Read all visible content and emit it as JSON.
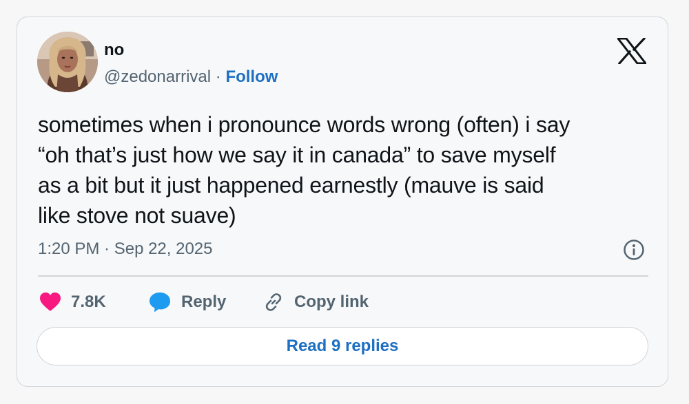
{
  "tweet": {
    "author": {
      "display_name": "no",
      "handle": "@zedonarrival",
      "separator": " · ",
      "follow_label": "Follow",
      "avatar_icon": "profile-photo"
    },
    "platform_icon": "x-logo-icon",
    "text_lines": [
      "sometimes when i pronounce words wrong (often) i say",
      "“oh that’s just how we say it in canada” to save myself",
      "as a bit but it just happened earnestly (mauve is said",
      "like stove not suave)"
    ],
    "timestamp": "1:20 PM · Sep 22, 2025",
    "info_icon": "info-icon",
    "actions": {
      "like": {
        "icon": "heart-icon",
        "count": "7.8K",
        "color": "#f91880"
      },
      "reply": {
        "icon": "speech-bubble-icon",
        "label": "Reply",
        "color": "#1d9bf0"
      },
      "copy_link": {
        "icon": "link-icon",
        "label": "Copy link"
      }
    },
    "read_replies_label": "Read 9 replies"
  },
  "colors": {
    "accent": "#1d6fc2",
    "secondary_text": "#536471",
    "primary_text": "#0f1419",
    "border": "#d3d6da"
  }
}
